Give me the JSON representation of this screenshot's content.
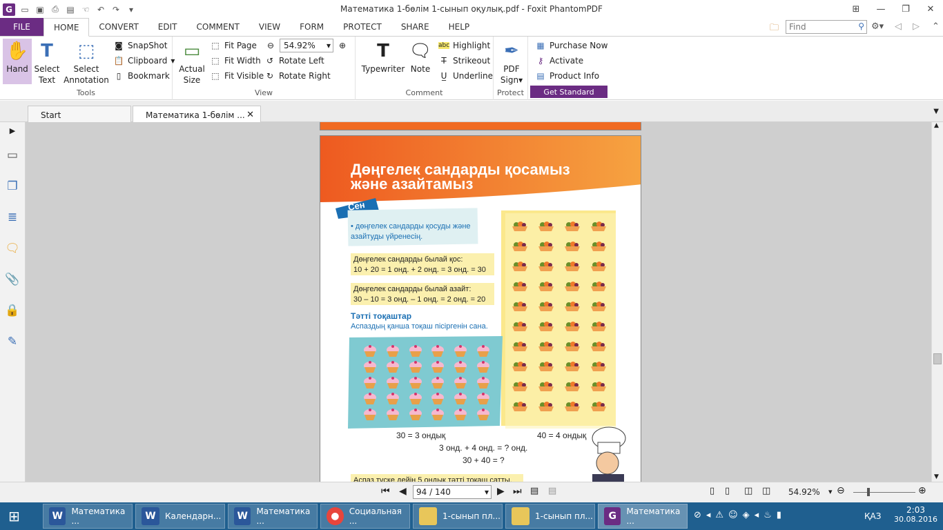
{
  "window": {
    "title": "Математика 1-бөлім 1-сынып оқулық.pdf - Foxit PhantomPDF",
    "app_letter": "G"
  },
  "menu": [
    "FILE",
    "HOME",
    "CONVERT",
    "EDIT",
    "COMMENT",
    "VIEW",
    "FORM",
    "PROTECT",
    "SHARE",
    "HELP"
  ],
  "find": {
    "placeholder": "Find"
  },
  "ribbon": {
    "hand": "Hand",
    "select_text": [
      "Select",
      "Text"
    ],
    "select_annotation": [
      "Select",
      "Annotation"
    ],
    "snapshot": "SnapShot",
    "clipboard": "Clipboard",
    "bookmark": "Bookmark",
    "tools_label": "Tools",
    "actual_size": [
      "Actual",
      "Size"
    ],
    "fit_page": "Fit Page",
    "fit_width": "Fit Width",
    "fit_visible": "Fit Visible",
    "zoom_value": "54.92%",
    "rotate_left": "Rotate Left",
    "rotate_right": "Rotate Right",
    "view_label": "View",
    "typewriter": "Typewriter",
    "note": "Note",
    "highlight": "Highlight",
    "strikeout": "Strikeout",
    "underline": "Underline",
    "comment_label": "Comment",
    "pdf_sign": [
      "PDF",
      "Sign"
    ],
    "protect_label": "Protect",
    "purchase": "Purchase Now",
    "activate": "Activate",
    "product_info": "Product Info",
    "get_standard": "Get Standard"
  },
  "tabs": {
    "start": "Start",
    "doc": "Математика 1-бөлім ..."
  },
  "page": {
    "title_line1": "Дөңгелек сандарды қосамыз",
    "title_line2": "және азайтамыз",
    "badge": "Сен",
    "goal": "дөңгелек сандарды қосуды және азайтуды үйренесің.",
    "add_head": "Дөңгелек сандарды былай қос:",
    "add_eq": "10 + 20 = 1 онд. + 2 онд. = 3 онд. = 30",
    "sub_head": "Дөңгелек сандарды былай азайт:",
    "sub_eq": "30 – 10 = 3 онд. – 1 онд. = 2 онд. = 20",
    "sweet_title": "Тәтті тоқаштар",
    "sweet_sub": "Аспаздың қанша тоқаш пісіргенін сана.",
    "eq1": "30 = 3 ондық",
    "eq2": "40 = 4 ондық",
    "eq3": "3 онд. + 4 онд. = ? онд.",
    "eq4": "30 + 40 = ?",
    "bottom": "Аспаз түске дейін 5 ондық тәтті тоқаш сатты."
  },
  "status": {
    "page_box": "94 / 140",
    "zoom": "54.92%"
  },
  "taskbar": {
    "items": [
      "Математика ...",
      "Календарн...",
      "Математика ...",
      "Социальная ...",
      "1-сынып пл...",
      "1-сынып пл...",
      "Математика ..."
    ],
    "lang": "ҚАЗ",
    "time": "2:03",
    "date": "30.08.2016"
  },
  "colors": {
    "accent": "#6b2c83",
    "orange": "#f06a22",
    "teal": "#7fcad1",
    "yellow": "#fbe88c"
  }
}
